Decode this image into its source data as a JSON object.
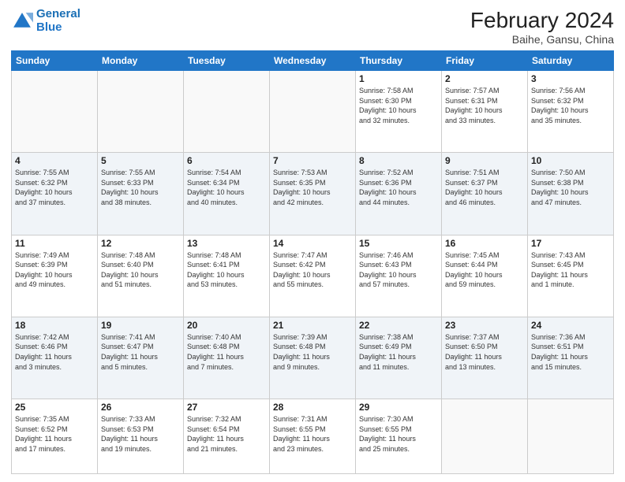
{
  "header": {
    "logo_line1": "General",
    "logo_line2": "Blue",
    "month_year": "February 2024",
    "location": "Baihe, Gansu, China"
  },
  "days_of_week": [
    "Sunday",
    "Monday",
    "Tuesday",
    "Wednesday",
    "Thursday",
    "Friday",
    "Saturday"
  ],
  "weeks": [
    [
      {
        "day": "",
        "info": ""
      },
      {
        "day": "",
        "info": ""
      },
      {
        "day": "",
        "info": ""
      },
      {
        "day": "",
        "info": ""
      },
      {
        "day": "1",
        "info": "Sunrise: 7:58 AM\nSunset: 6:30 PM\nDaylight: 10 hours\nand 32 minutes."
      },
      {
        "day": "2",
        "info": "Sunrise: 7:57 AM\nSunset: 6:31 PM\nDaylight: 10 hours\nand 33 minutes."
      },
      {
        "day": "3",
        "info": "Sunrise: 7:56 AM\nSunset: 6:32 PM\nDaylight: 10 hours\nand 35 minutes."
      }
    ],
    [
      {
        "day": "4",
        "info": "Sunrise: 7:55 AM\nSunset: 6:32 PM\nDaylight: 10 hours\nand 37 minutes."
      },
      {
        "day": "5",
        "info": "Sunrise: 7:55 AM\nSunset: 6:33 PM\nDaylight: 10 hours\nand 38 minutes."
      },
      {
        "day": "6",
        "info": "Sunrise: 7:54 AM\nSunset: 6:34 PM\nDaylight: 10 hours\nand 40 minutes."
      },
      {
        "day": "7",
        "info": "Sunrise: 7:53 AM\nSunset: 6:35 PM\nDaylight: 10 hours\nand 42 minutes."
      },
      {
        "day": "8",
        "info": "Sunrise: 7:52 AM\nSunset: 6:36 PM\nDaylight: 10 hours\nand 44 minutes."
      },
      {
        "day": "9",
        "info": "Sunrise: 7:51 AM\nSunset: 6:37 PM\nDaylight: 10 hours\nand 46 minutes."
      },
      {
        "day": "10",
        "info": "Sunrise: 7:50 AM\nSunset: 6:38 PM\nDaylight: 10 hours\nand 47 minutes."
      }
    ],
    [
      {
        "day": "11",
        "info": "Sunrise: 7:49 AM\nSunset: 6:39 PM\nDaylight: 10 hours\nand 49 minutes."
      },
      {
        "day": "12",
        "info": "Sunrise: 7:48 AM\nSunset: 6:40 PM\nDaylight: 10 hours\nand 51 minutes."
      },
      {
        "day": "13",
        "info": "Sunrise: 7:48 AM\nSunset: 6:41 PM\nDaylight: 10 hours\nand 53 minutes."
      },
      {
        "day": "14",
        "info": "Sunrise: 7:47 AM\nSunset: 6:42 PM\nDaylight: 10 hours\nand 55 minutes."
      },
      {
        "day": "15",
        "info": "Sunrise: 7:46 AM\nSunset: 6:43 PM\nDaylight: 10 hours\nand 57 minutes."
      },
      {
        "day": "16",
        "info": "Sunrise: 7:45 AM\nSunset: 6:44 PM\nDaylight: 10 hours\nand 59 minutes."
      },
      {
        "day": "17",
        "info": "Sunrise: 7:43 AM\nSunset: 6:45 PM\nDaylight: 11 hours\nand 1 minute."
      }
    ],
    [
      {
        "day": "18",
        "info": "Sunrise: 7:42 AM\nSunset: 6:46 PM\nDaylight: 11 hours\nand 3 minutes."
      },
      {
        "day": "19",
        "info": "Sunrise: 7:41 AM\nSunset: 6:47 PM\nDaylight: 11 hours\nand 5 minutes."
      },
      {
        "day": "20",
        "info": "Sunrise: 7:40 AM\nSunset: 6:48 PM\nDaylight: 11 hours\nand 7 minutes."
      },
      {
        "day": "21",
        "info": "Sunrise: 7:39 AM\nSunset: 6:48 PM\nDaylight: 11 hours\nand 9 minutes."
      },
      {
        "day": "22",
        "info": "Sunrise: 7:38 AM\nSunset: 6:49 PM\nDaylight: 11 hours\nand 11 minutes."
      },
      {
        "day": "23",
        "info": "Sunrise: 7:37 AM\nSunset: 6:50 PM\nDaylight: 11 hours\nand 13 minutes."
      },
      {
        "day": "24",
        "info": "Sunrise: 7:36 AM\nSunset: 6:51 PM\nDaylight: 11 hours\nand 15 minutes."
      }
    ],
    [
      {
        "day": "25",
        "info": "Sunrise: 7:35 AM\nSunset: 6:52 PM\nDaylight: 11 hours\nand 17 minutes."
      },
      {
        "day": "26",
        "info": "Sunrise: 7:33 AM\nSunset: 6:53 PM\nDaylight: 11 hours\nand 19 minutes."
      },
      {
        "day": "27",
        "info": "Sunrise: 7:32 AM\nSunset: 6:54 PM\nDaylight: 11 hours\nand 21 minutes."
      },
      {
        "day": "28",
        "info": "Sunrise: 7:31 AM\nSunset: 6:55 PM\nDaylight: 11 hours\nand 23 minutes."
      },
      {
        "day": "29",
        "info": "Sunrise: 7:30 AM\nSunset: 6:55 PM\nDaylight: 11 hours\nand 25 minutes."
      },
      {
        "day": "",
        "info": ""
      },
      {
        "day": "",
        "info": ""
      }
    ]
  ]
}
